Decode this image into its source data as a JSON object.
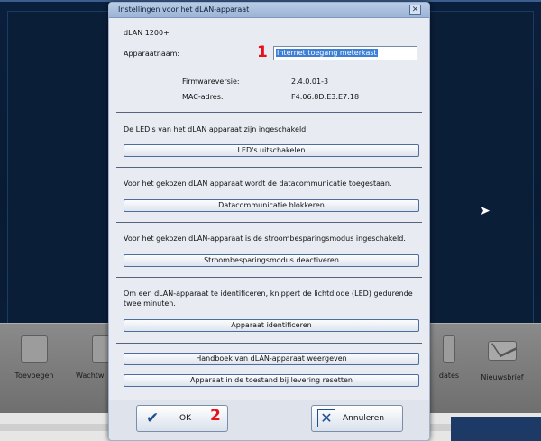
{
  "dialog": {
    "title": "Instellingen voor het dLAN-apparaat",
    "close_glyph": "✕",
    "device_model": "dLAN 1200+",
    "device_name_label": "Apparaatnaam:",
    "device_name_value": "Internet toegang meterkast",
    "firmware_label": "Firmwareversie:",
    "firmware_value": "2.4.0.01-3",
    "mac_label": "MAC-adres:",
    "mac_value": "F4:06:8D:E3:E7:18",
    "led_text": "De LED's van het dLAN apparaat zijn ingeschakeld.",
    "led_button": "LED's uitschakelen",
    "data_text": "Voor het gekozen dLAN apparaat wordt de datacommunicatie toegestaan.",
    "data_button": "Datacommunicatie blokkeren",
    "power_text": "Voor het gekozen dLAN-apparaat is de stroombesparingsmodus ingeschakeld.",
    "power_button": "Stroombesparingsmodus deactiveren",
    "identify_text": "Om een dLAN-apparaat te identificeren, knippert de lichtdiode (LED) gedurende twee minuten.",
    "identify_button": "Apparaat identificeren",
    "manual_button": "Handboek van dLAN-apparaat weergeven",
    "reset_button": "Apparaat in de toestand bij levering resetten",
    "ok_button": "OK",
    "cancel_button": "Annuleren"
  },
  "annotations": {
    "marker_1": "1",
    "marker_2": "2",
    "color": "#e4131b"
  },
  "background_toolbar": {
    "items": [
      "Toevoegen",
      "Wachtw",
      "dates",
      "Nieuwsbrief"
    ]
  },
  "colors": {
    "app_background": "#07162b",
    "dialog_background": "#e8ebf2",
    "selection": "#3d7fd6"
  }
}
